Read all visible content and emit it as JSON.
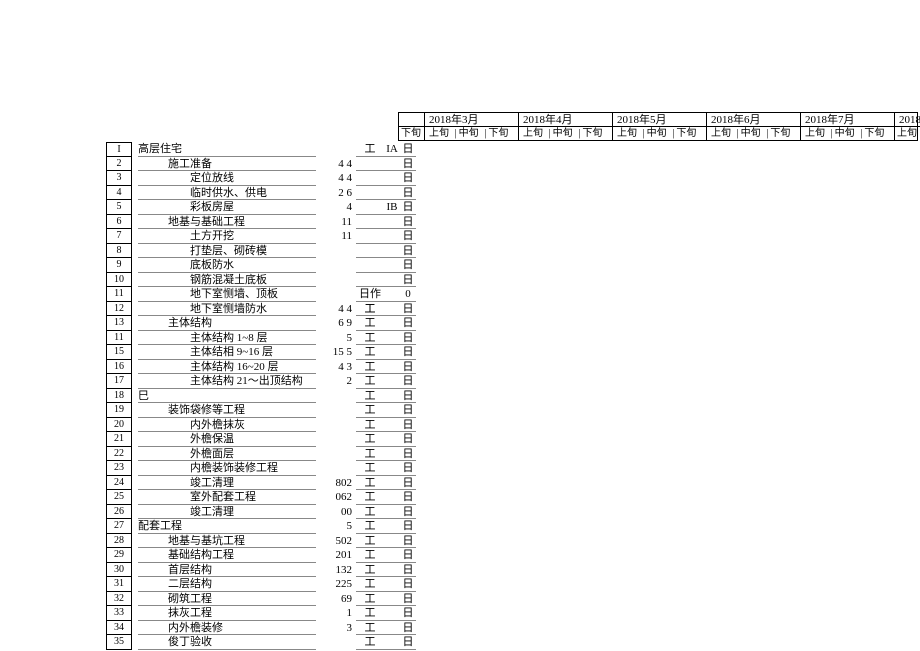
{
  "gantt": {
    "months": [
      "2018年3月",
      "2018年4月",
      "2018年5月",
      "2018年6月",
      "2018年7月",
      "2018"
    ],
    "prev_last": "下旬",
    "sub": [
      "上旬",
      "中旬",
      "下旬"
    ],
    "last_sub": "上旬"
  },
  "rows": [
    {
      "id": "I",
      "name": "高层住宅",
      "lvl": 1,
      "val": "",
      "a": "工",
      "b": "IA",
      "u": "日"
    },
    {
      "id": "2",
      "name": "施工准备",
      "lvl": 2,
      "val": "4 4",
      "a": "",
      "b": "",
      "u": "日"
    },
    {
      "id": "3",
      "name": "定位放线",
      "lvl": 3,
      "val": "4 4",
      "a": "",
      "b": "",
      "u": "日"
    },
    {
      "id": "4",
      "name": "临时供水、供电",
      "lvl": 3,
      "val": "2 6",
      "a": "",
      "b": "",
      "u": "日"
    },
    {
      "id": "5",
      "name": "彩板房屋",
      "lvl": 3,
      "val": "4",
      "a": "",
      "b": "IB",
      "u": "日"
    },
    {
      "id": "6",
      "name": "地基与基础工程",
      "lvl": 2,
      "val": "11",
      "a": "",
      "b": "",
      "u": "日"
    },
    {
      "id": "7",
      "name": "土方开挖",
      "lvl": 3,
      "val": "11",
      "a": "",
      "b": "",
      "u": "日"
    },
    {
      "id": "8",
      "name": "打垫层、砌砖模",
      "lvl": 3,
      "val": "",
      "a": "",
      "b": "",
      "u": "日"
    },
    {
      "id": "9",
      "name": "底板防水",
      "lvl": 3,
      "val": "",
      "a": "",
      "b": "",
      "u": "日"
    },
    {
      "id": "10",
      "name": "钢筋混凝土底板",
      "lvl": 3,
      "val": "",
      "a": "",
      "b": "",
      "u": "日"
    },
    {
      "id": "11",
      "name": "地下室恻墙、顶板",
      "lvl": 3,
      "val": "",
      "a": "日作工",
      "b": "",
      "u": "0"
    },
    {
      "id": "12",
      "name": "地下室恻墙防水",
      "lvl": 3,
      "val": "4 4",
      "a": "工",
      "b": "",
      "u": "日"
    },
    {
      "id": "13",
      "name": "主体结构",
      "lvl": 2,
      "val": "6 9",
      "a": "工",
      "b": "",
      "u": "日"
    },
    {
      "id": "11",
      "name": "主体结构 1~8 层",
      "lvl": 3,
      "val": "5",
      "a": "工",
      "b": "",
      "u": "日"
    },
    {
      "id": "15",
      "name": "主体结相 9~16 层",
      "lvl": 3,
      "val": "15 5",
      "a": "工",
      "b": "",
      "u": "日"
    },
    {
      "id": "16",
      "name": "主体结构 16~20 层",
      "lvl": 3,
      "val": "4 3",
      "a": "工",
      "b": "",
      "u": "日"
    },
    {
      "id": "17",
      "name": "主体结构 21～出顶结构",
      "lvl": 3,
      "val": "2",
      "a": "工",
      "b": "",
      "u": "日"
    },
    {
      "id": "18",
      "name": "巳",
      "lvl": 1,
      "val": "",
      "a": "工",
      "b": "",
      "u": "日"
    },
    {
      "id": "19",
      "name": "装饰袋修等工程",
      "lvl": 2,
      "val": "",
      "a": "工",
      "b": "",
      "u": "日"
    },
    {
      "id": "20",
      "name": "内外檐抹灰",
      "lvl": 3,
      "val": "",
      "a": "工",
      "b": "",
      "u": "日"
    },
    {
      "id": "21",
      "name": "外檐保温",
      "lvl": 3,
      "val": "",
      "a": "工",
      "b": "",
      "u": "日"
    },
    {
      "id": "22",
      "name": "外檐面层",
      "lvl": 3,
      "val": "",
      "a": "工",
      "b": "",
      "u": "日"
    },
    {
      "id": "23",
      "name": "内檐装饰装修工程",
      "lvl": 3,
      "val": "",
      "a": "工",
      "b": "",
      "u": "日"
    },
    {
      "id": "24",
      "name": "竣工清理",
      "lvl": 3,
      "val": "802",
      "a": "工",
      "b": "",
      "u": "日"
    },
    {
      "id": "25",
      "name": "室外配套工程",
      "lvl": 3,
      "val": "062",
      "a": "工",
      "b": "",
      "u": "日"
    },
    {
      "id": "26",
      "name": "竣工清理",
      "lvl": 3,
      "val": "00",
      "a": "工",
      "b": "",
      "u": "日"
    },
    {
      "id": "27",
      "name": "配套工程",
      "lvl": 1,
      "val": "5",
      "a": "工",
      "b": "",
      "u": "日"
    },
    {
      "id": "28",
      "name": "地基与基坑工程",
      "lvl": 2,
      "val": "502",
      "a": "工",
      "b": "",
      "u": "日"
    },
    {
      "id": "29",
      "name": "基础结构工程",
      "lvl": 2,
      "val": "201",
      "a": "工",
      "b": "",
      "u": "日"
    },
    {
      "id": "30",
      "name": "首层结构",
      "lvl": 2,
      "val": "132",
      "a": "工",
      "b": "",
      "u": "日"
    },
    {
      "id": "31",
      "name": "二层结构",
      "lvl": 2,
      "val": "225",
      "a": "工",
      "b": "",
      "u": "日"
    },
    {
      "id": "32",
      "name": "砌筑工程",
      "lvl": 2,
      "val": "69",
      "a": "工",
      "b": "",
      "u": "日"
    },
    {
      "id": "33",
      "name": "抹灰工程",
      "lvl": 2,
      "val": "1",
      "a": "工",
      "b": "",
      "u": "日"
    },
    {
      "id": "34",
      "name": "内外檐装修",
      "lvl": 2,
      "val": "3",
      "a": "工",
      "b": "",
      "u": "日"
    },
    {
      "id": "35",
      "name": "俊丁验收",
      "lvl": 2,
      "val": "",
      "a": "工",
      "b": "",
      "u": "日"
    }
  ]
}
